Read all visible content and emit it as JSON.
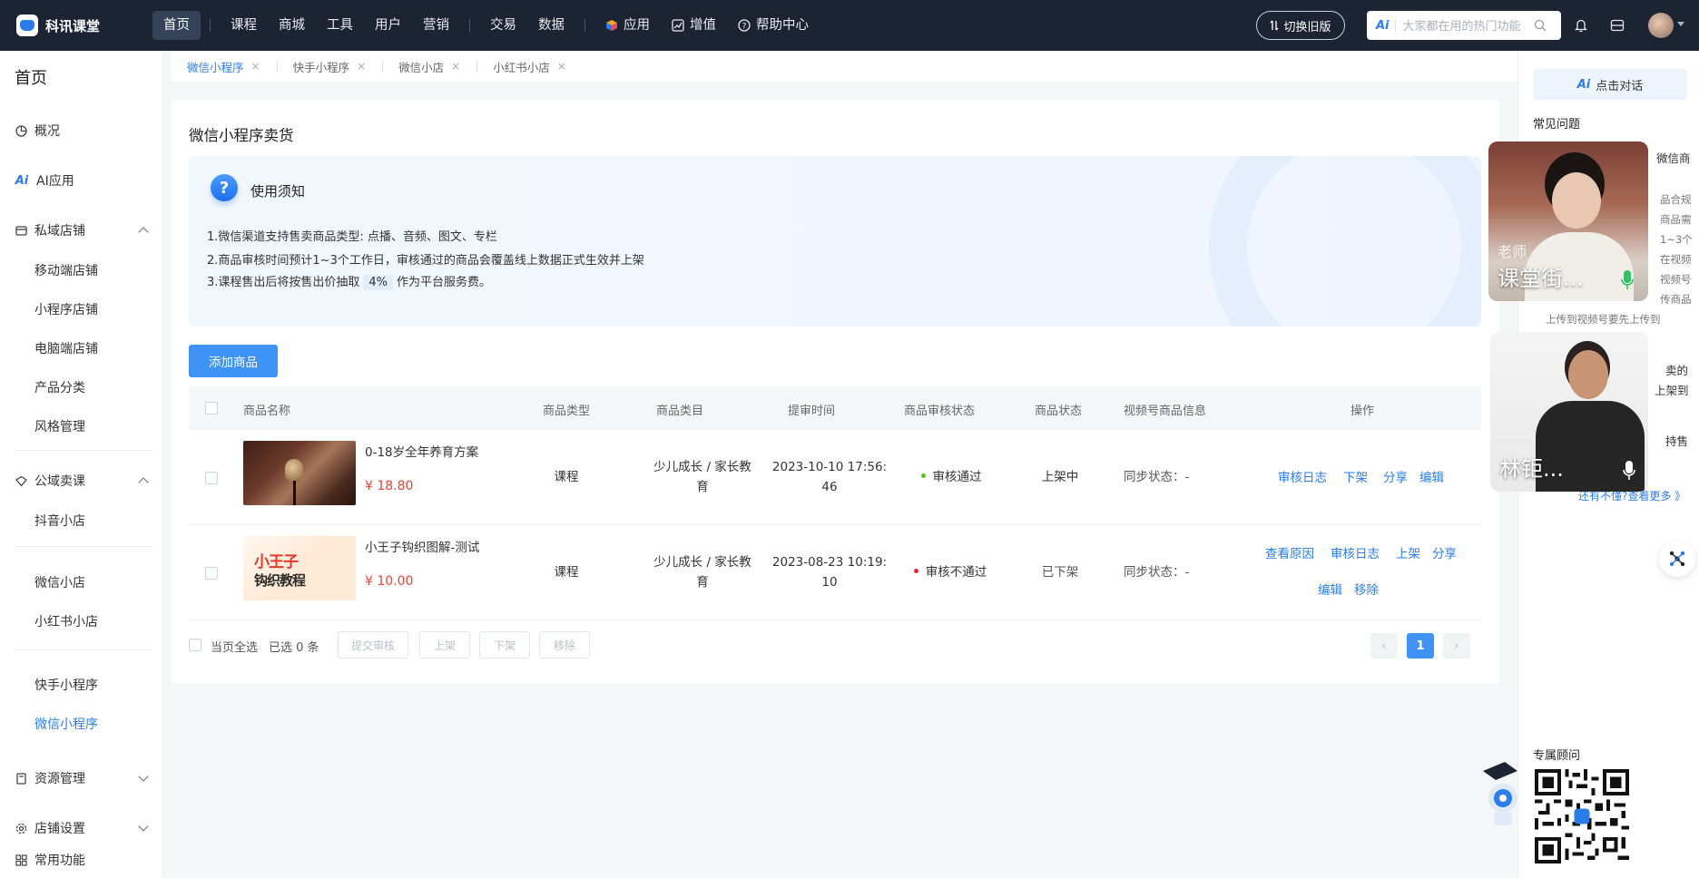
{
  "app": {
    "logo_text": "科讯课堂",
    "nav": [
      {
        "label": "首页",
        "active": true
      },
      {
        "label": "课程"
      },
      {
        "label": "商城"
      },
      {
        "label": "工具"
      },
      {
        "label": "用户"
      },
      {
        "label": "营销"
      },
      {
        "label": "交易"
      },
      {
        "label": "数据"
      },
      {
        "label": "应用",
        "icon": "cube-icon"
      },
      {
        "label": "增值",
        "icon": "chart-icon"
      },
      {
        "label": "帮助中心",
        "icon": "help-icon"
      }
    ],
    "switch_label": "切换旧版",
    "search": {
      "ai_tag": "Ai",
      "placeholder": "大家都在用的热门功能"
    }
  },
  "sidebar": {
    "title": "首页",
    "items": [
      {
        "label": "概况",
        "icon": "pie-chart-icon"
      },
      {
        "label": "AI应用",
        "icon": "ai-icon"
      },
      {
        "label": "私域店铺",
        "icon": "store-icon",
        "expanded": true
      },
      {
        "label": "移动端店铺"
      },
      {
        "label": "小程序店铺"
      },
      {
        "label": "电脑端店铺"
      },
      {
        "label": "产品分类"
      },
      {
        "label": "风格管理"
      },
      {
        "label": "公域卖课",
        "icon": "diamond-icon",
        "expanded": true
      },
      {
        "label": "抖音小店"
      },
      {
        "label": "微信小店"
      },
      {
        "label": "小红书小店"
      },
      {
        "label": "快手小程序"
      },
      {
        "label": "微信小程序",
        "active": true
      },
      {
        "label": "资源管理",
        "icon": "resource-icon",
        "expanded": false
      },
      {
        "label": "店铺设置",
        "icon": "settings-icon",
        "expanded": false
      },
      {
        "label": "常用功能",
        "icon": "grid-icon"
      }
    ]
  },
  "tabs": [
    {
      "label": "微信小程序",
      "active": true
    },
    {
      "label": "快手小程序"
    },
    {
      "label": "微信小店"
    },
    {
      "label": "小红书小店"
    }
  ],
  "page": {
    "title": "微信小程序卖货",
    "notice": {
      "title": "使用须知",
      "line1": "1.微信渠道支持售卖商品类型: 点播、音频、图文、专栏",
      "line2": "2.商品审核时间预计1~3个工作日，审核通过的商品会覆盖线上数据正式生效并上架",
      "line3_pre": "3.课程售出后将按售出价抽取",
      "line3_pct": "4%",
      "line3_post": "作为平台服务费。"
    },
    "add_button": "添加商品",
    "table": {
      "headers": [
        "商品名称",
        "商品类型",
        "商品类目",
        "提审时间",
        "商品审核状态",
        "商品状态",
        "视频号商品信息",
        "操作"
      ],
      "rows": [
        {
          "name": "0-18岁全年养育方案",
          "price": "¥ 18.80",
          "type": "课程",
          "category_1": "少儿成长 / 家长教",
          "category_2": "育",
          "time_1": "2023-10-10 17:56:",
          "time_2": "46",
          "review": "审核通过",
          "review_color": "#52c41a",
          "status": "上架中",
          "sync": "同步状态：-",
          "ops": [
            "审核日志",
            "下架",
            "分享",
            "编辑"
          ]
        },
        {
          "name": "小王子钩织图解-测试",
          "price": "¥ 10.00",
          "thumb_word": "小王子",
          "thumb_sub": "钩织教程",
          "type": "课程",
          "category_1": "少儿成长 / 家长教",
          "category_2": "育",
          "time_1": "2023-08-23 10:19:",
          "time_2": "10",
          "review": "审核不通过",
          "review_color": "#f5222d",
          "status": "已下架",
          "sync": "同步状态：-",
          "ops": [
            "查看原因",
            "审核日志",
            "上架",
            "分享",
            "编辑",
            "移除"
          ]
        }
      ]
    },
    "footer": {
      "select_all": "当页全选",
      "selected": "已选 0 条",
      "buttons": [
        "提交审核",
        "上架",
        "下架",
        "移除"
      ],
      "current_page": "1"
    }
  },
  "right_panel": {
    "ai_chat": {
      "tag": "Ai",
      "label": "点击对话"
    },
    "faq_title": "常见问题",
    "faq_lines": [
      "微信商",
      "品合规",
      "商品需",
      "1~3个",
      "在视频",
      "视频号",
      "传商品",
      "上传到视频号要先上传到",
      "卖的",
      "上架到",
      "持售"
    ],
    "faq_more": "还有不懂?查看更多 》",
    "advisor_title": "专属顾问"
  },
  "videos": [
    {
      "name": "课堂街...",
      "tag": "老师"
    },
    {
      "name": "林钜..."
    }
  ],
  "colors": {
    "accent": "#2b7de9",
    "topbar": "#1c2433",
    "price": "#e8453c"
  }
}
